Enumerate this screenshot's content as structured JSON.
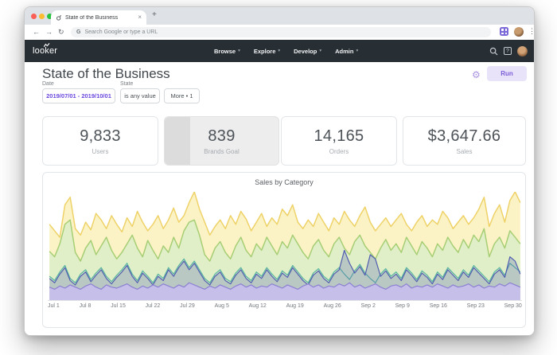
{
  "browser": {
    "tab_title": "State of the Business",
    "address_placeholder": "Search Google or type a URL"
  },
  "icons": {
    "back": "←",
    "forward": "→",
    "refresh": "↻",
    "new_tab": "+",
    "close_tab": "×",
    "menu_dots": "⋮",
    "google": "G",
    "gear": "⚙",
    "help": "?",
    "caret": "▾"
  },
  "navbar": {
    "logo": "looker",
    "menus": [
      {
        "label": "Browse"
      },
      {
        "label": "Explore"
      },
      {
        "label": "Develop"
      },
      {
        "label": "Admin"
      }
    ]
  },
  "header": {
    "title": "State of the Business",
    "run_label": "Run"
  },
  "filters": {
    "date": {
      "label": "Date",
      "value": "2019/07/01 - 2019/10/01"
    },
    "state": {
      "label": "State",
      "value": "is any value"
    },
    "more": {
      "value": "More • 1"
    }
  },
  "kpis": [
    {
      "value": "9,833",
      "label": "Users"
    },
    {
      "value": "839",
      "label": "Brands Goal"
    },
    {
      "value": "14,165",
      "label": "Orders"
    },
    {
      "value": "$3,647.66",
      "label": "Sales"
    }
  ],
  "colors": {
    "traffic_red": "#f95f57",
    "traffic_yellow": "#fcbc2f",
    "traffic_green": "#29c340",
    "navbar_bg": "#272e34",
    "looker_purple": "#7a5cd8",
    "run_bg": "#e9e3f9",
    "ghost_card_bg": "#ededed",
    "ghost_strip": "#dcdcdc"
  },
  "chart_data": {
    "type": "area",
    "title": "Sales by Category",
    "xlabel": "",
    "ylabel": "",
    "ylim": [
      0,
      100
    ],
    "grid": false,
    "legend": "none",
    "x_tick_labels": [
      "Jul 1",
      "Jul 8",
      "Jul 15",
      "Jul 22",
      "Jul 29",
      "Aug 5",
      "Aug 12",
      "Aug 19",
      "Aug 26",
      "Sep 2",
      "Sep 9",
      "Sep 16",
      "Sep 23",
      "Sep 30"
    ],
    "x_range_days": 92,
    "series": [
      {
        "name": "yellow",
        "stroke": "#eed267",
        "fill": "#fbf3c6",
        "width": 1.5,
        "values": [
          70,
          64,
          58,
          88,
          95,
          66,
          60,
          72,
          65,
          80,
          74,
          66,
          78,
          70,
          63,
          76,
          68,
          82,
          72,
          64,
          70,
          78,
          66,
          74,
          85,
          72,
          78,
          90,
          100,
          84,
          72,
          60,
          68,
          74,
          66,
          78,
          70,
          82,
          75,
          64,
          72,
          80,
          68,
          76,
          70,
          84,
          78,
          88,
          72,
          66,
          74,
          68,
          80,
          72,
          64,
          76,
          70,
          82,
          74,
          68,
          78,
          86,
          72,
          64,
          70,
          76,
          68,
          74,
          80,
          70,
          64,
          72,
          78,
          68,
          74,
          70,
          82,
          76,
          66,
          72,
          78,
          70,
          76,
          84,
          95,
          68,
          80,
          88,
          72,
          92,
          100,
          90
        ]
      },
      {
        "name": "green",
        "stroke": "#a6ce74",
        "fill": "#e1efc8",
        "width": 1.5,
        "values": [
          45,
          40,
          52,
          70,
          74,
          44,
          36,
          48,
          55,
          42,
          50,
          58,
          46,
          38,
          44,
          52,
          60,
          48,
          40,
          55,
          46,
          38,
          50,
          44,
          58,
          48,
          64,
          72,
          74,
          60,
          42,
          36,
          48,
          54,
          44,
          38,
          50,
          58,
          46,
          40,
          52,
          46,
          58,
          50,
          42,
          54,
          48,
          60,
          52,
          44,
          38,
          50,
          56,
          46,
          40,
          52,
          58,
          48,
          42,
          54,
          60,
          50,
          44,
          38,
          48,
          56,
          46,
          52,
          44,
          58,
          50,
          42,
          54,
          48,
          40,
          52,
          46,
          58,
          50,
          44,
          56,
          48,
          60,
          54,
          66,
          40,
          52,
          58,
          48,
          64,
          58,
          52
        ]
      },
      {
        "name": "teal",
        "stroke": "#55b39f",
        "fill": null,
        "width": 1.2,
        "values": [
          22,
          18,
          26,
          32,
          20,
          16,
          24,
          28,
          19,
          25,
          30,
          22,
          17,
          23,
          28,
          34,
          24,
          18,
          27,
          22,
          16,
          24,
          20,
          30,
          24,
          32,
          38,
          30,
          36,
          28,
          20,
          16,
          24,
          28,
          20,
          17,
          25,
          30,
          22,
          18,
          26,
          22,
          30,
          24,
          19,
          27,
          23,
          32,
          26,
          20,
          16,
          25,
          29,
          22,
          18,
          26,
          30,
          24,
          19,
          27,
          33,
          25,
          20,
          16,
          24,
          29,
          22,
          26,
          20,
          30,
          25,
          19,
          27,
          23,
          17,
          26,
          21,
          30,
          25,
          20,
          28,
          23,
          32,
          27,
          22,
          17,
          26,
          30,
          23,
          34,
          30,
          26
        ]
      },
      {
        "name": "indigo",
        "stroke": "#4f5cb0",
        "fill": "rgba(95,110,185,0.30)",
        "width": 1.2,
        "values": [
          20,
          16,
          24,
          30,
          18,
          14,
          22,
          26,
          17,
          23,
          28,
          20,
          15,
          21,
          26,
          32,
          22,
          16,
          25,
          20,
          14,
          22,
          18,
          28,
          22,
          30,
          36,
          28,
          34,
          26,
          18,
          14,
          22,
          26,
          18,
          15,
          23,
          28,
          20,
          16,
          24,
          20,
          28,
          22,
          17,
          25,
          21,
          30,
          24,
          18,
          14,
          23,
          27,
          20,
          16,
          24,
          28,
          46,
          34,
          25,
          31,
          23,
          42,
          38,
          22,
          27,
          20,
          24,
          18,
          28,
          23,
          17,
          25,
          21,
          15,
          24,
          19,
          28,
          23,
          18,
          26,
          21,
          30,
          25,
          20,
          15,
          24,
          28,
          21,
          40,
          36,
          24
        ]
      },
      {
        "name": "purple",
        "stroke": "#8b80d2",
        "fill": "#c6bfe9",
        "width": 1.2,
        "values": [
          12,
          10,
          13,
          11,
          14,
          12,
          10,
          13,
          15,
          12,
          10,
          14,
          12,
          11,
          13,
          15,
          12,
          10,
          13,
          11,
          14,
          12,
          15,
          13,
          11,
          14,
          12,
          16,
          14,
          12,
          10,
          13,
          11,
          14,
          12,
          10,
          13,
          15,
          12,
          14,
          11,
          13,
          12,
          15,
          13,
          11,
          14,
          12,
          10,
          13,
          15,
          12,
          14,
          11,
          13,
          12,
          15,
          13,
          16,
          12,
          14,
          11,
          13,
          15,
          12,
          10,
          13,
          14,
          12,
          15,
          11,
          13,
          12,
          14,
          12,
          15,
          13,
          11,
          14,
          12,
          13,
          15,
          12,
          14,
          11,
          13,
          12,
          15,
          13,
          16,
          14,
          12
        ]
      }
    ]
  }
}
